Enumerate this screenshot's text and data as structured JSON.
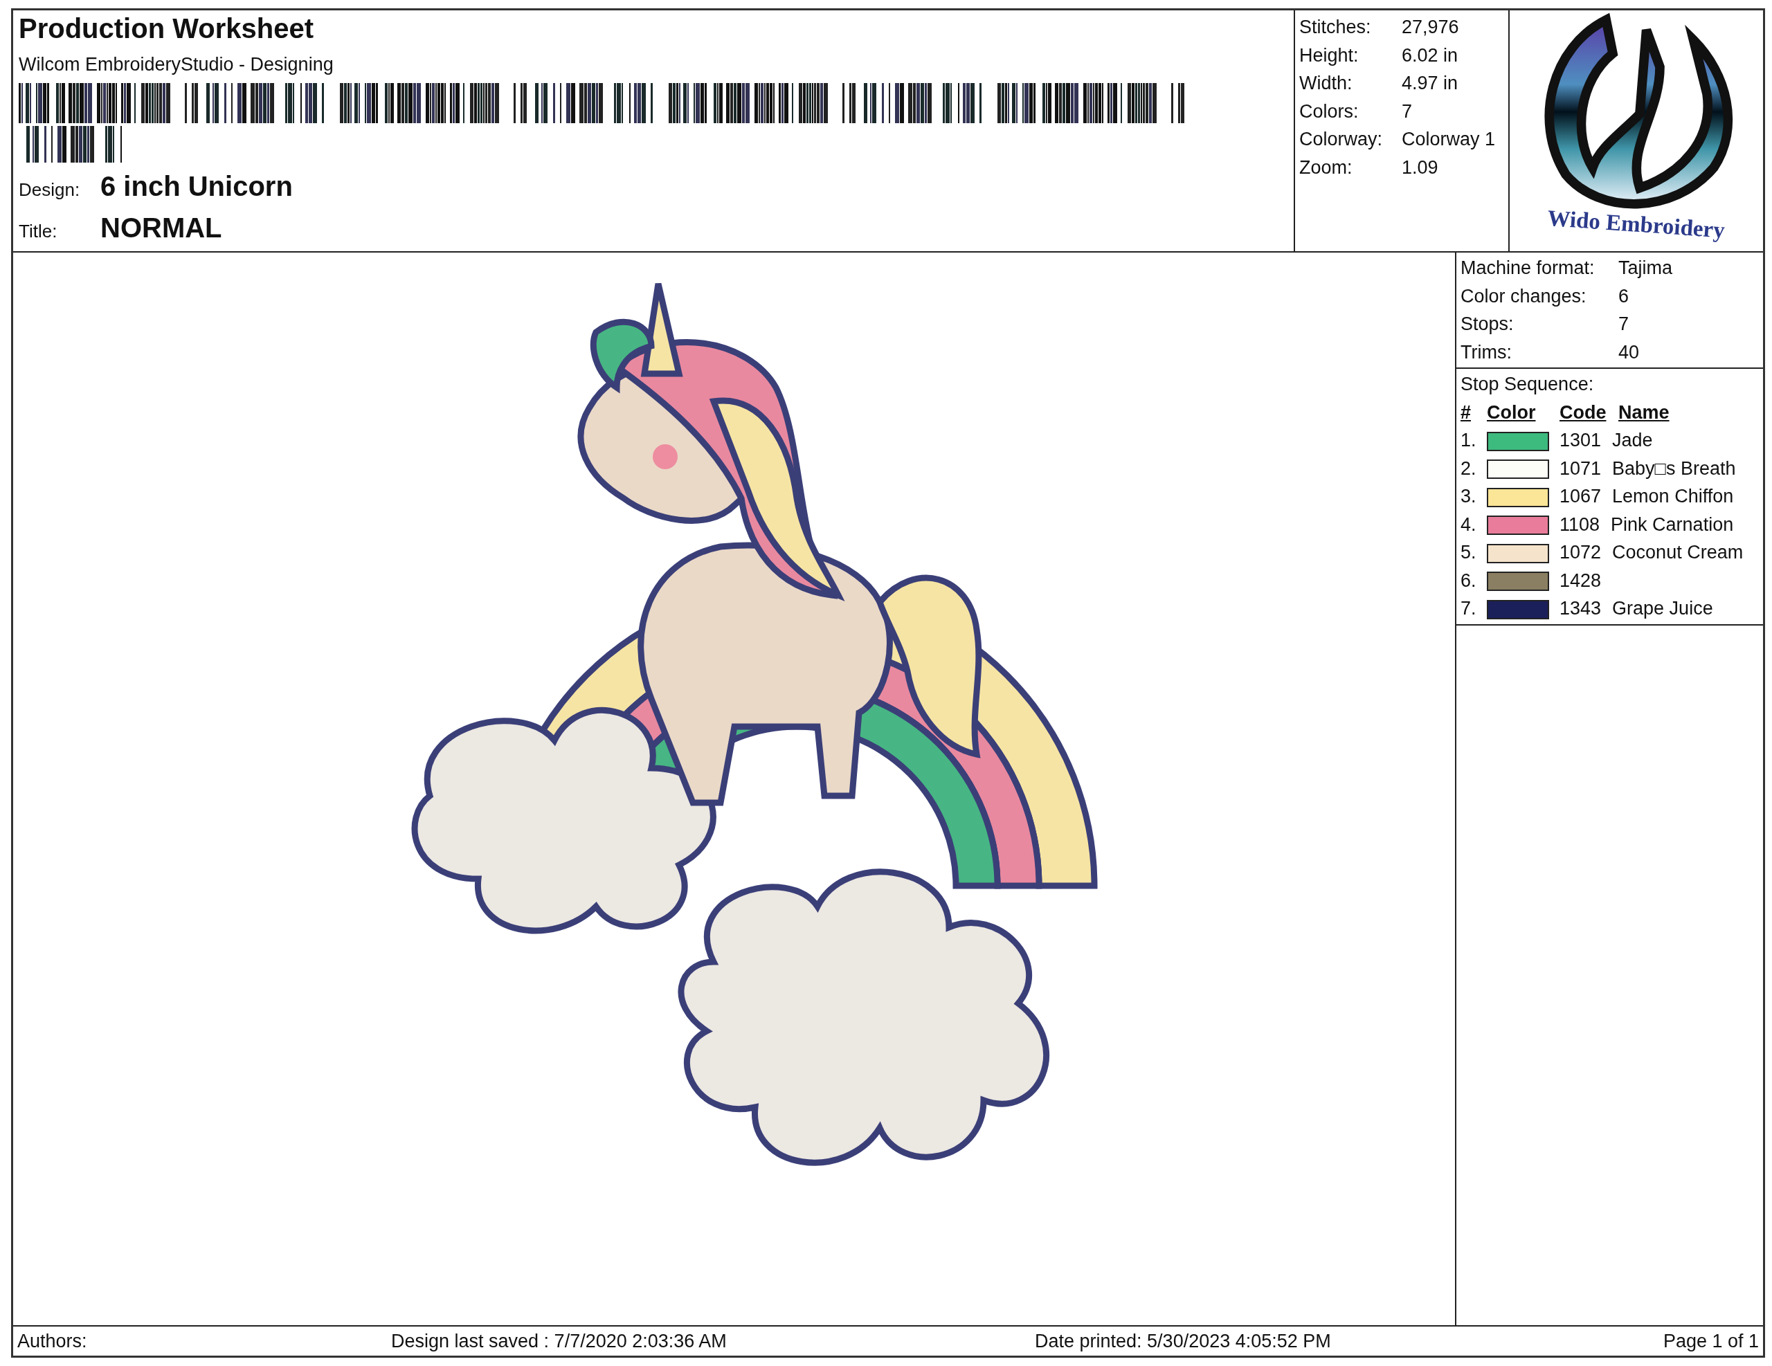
{
  "header": {
    "title": "Production Worksheet",
    "subtitle": "Wilcom EmbroideryStudio - Designing",
    "fields": [
      {
        "label": "Design:",
        "value": "6 inch Unicorn"
      },
      {
        "label": "Title:",
        "value": "NORMAL"
      }
    ]
  },
  "stats": [
    {
      "label": "Stitches:",
      "value": "27,976"
    },
    {
      "label": "Height:",
      "value": "6.02 in"
    },
    {
      "label": "Width:",
      "value": "4.97 in"
    },
    {
      "label": "Colors:",
      "value": "7"
    },
    {
      "label": "Colorway:",
      "value": "Colorway 1"
    },
    {
      "label": "Zoom:",
      "value": "1.09"
    }
  ],
  "logo": {
    "text": "Wido Embroidery"
  },
  "machine": [
    {
      "label": "Machine format:",
      "value": "Tajima"
    },
    {
      "label": "Color changes:",
      "value": "6"
    },
    {
      "label": "Stops:",
      "value": "7"
    },
    {
      "label": "Trims:",
      "value": "40"
    }
  ],
  "stop_sequence": {
    "title": "Stop Sequence:",
    "columns": [
      "#",
      "Color",
      "Code",
      "Name"
    ],
    "rows": [
      {
        "number": "1.",
        "color": "#3dba7e",
        "code": "1301",
        "name": "Jade"
      },
      {
        "number": "2.",
        "color": "#fdfdf8",
        "code": "1071",
        "name": "Baby□s Breath"
      },
      {
        "number": "3.",
        "color": "#fbe596",
        "code": "1067",
        "name": "Lemon Chiffon"
      },
      {
        "number": "4.",
        "color": "#e97c9a",
        "code": "1108",
        "name": "Pink Carnation"
      },
      {
        "number": "5.",
        "color": "#f5e3cb",
        "code": "1072",
        "name": "Coconut Cream"
      },
      {
        "number": "6.",
        "color": "#8a7f62",
        "code": "1428"
      },
      {
        "number": "7.",
        "color": "#1b1f5a",
        "code": "1343",
        "name": "Grape Juice"
      }
    ]
  },
  "footer": {
    "authors": "Authors:",
    "saved": "Design last saved : 7/7/2020 2:03:36 AM",
    "printed": "Date printed: 5/30/2023 4:05:52 PM",
    "page": "Page 1 of 1"
  }
}
